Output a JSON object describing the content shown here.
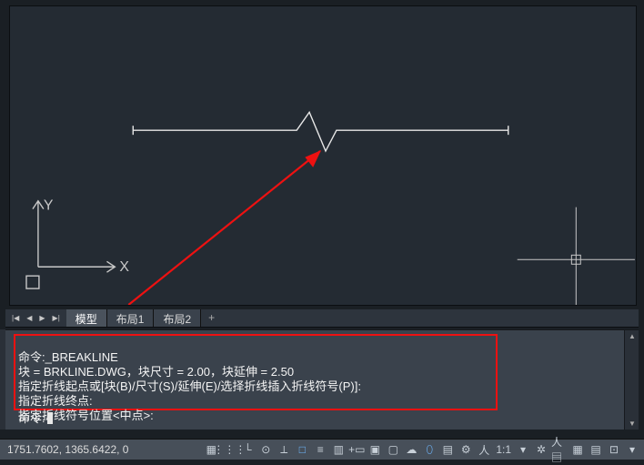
{
  "tabs": {
    "model": "模型",
    "layout1": "布局1",
    "layout2": "布局2"
  },
  "command": {
    "line1": "命令:_BREAKLINE",
    "line2": "块 = BRKLINE.DWG，块尺寸 = 2.00，块延伸 = 2.50",
    "line3": "指定折线起点或[块(B)/尺寸(S)/延伸(E)/选择折线插入折线符号(P)]:",
    "line4": "指定折线终点:",
    "line5": "指定折线符号位置<中点>:",
    "prompt": "命令:"
  },
  "status": {
    "coords": "1751.7602, 1365.6422, 0",
    "scale": "1:1"
  },
  "ucs": {
    "x": "X",
    "y": "Y"
  }
}
